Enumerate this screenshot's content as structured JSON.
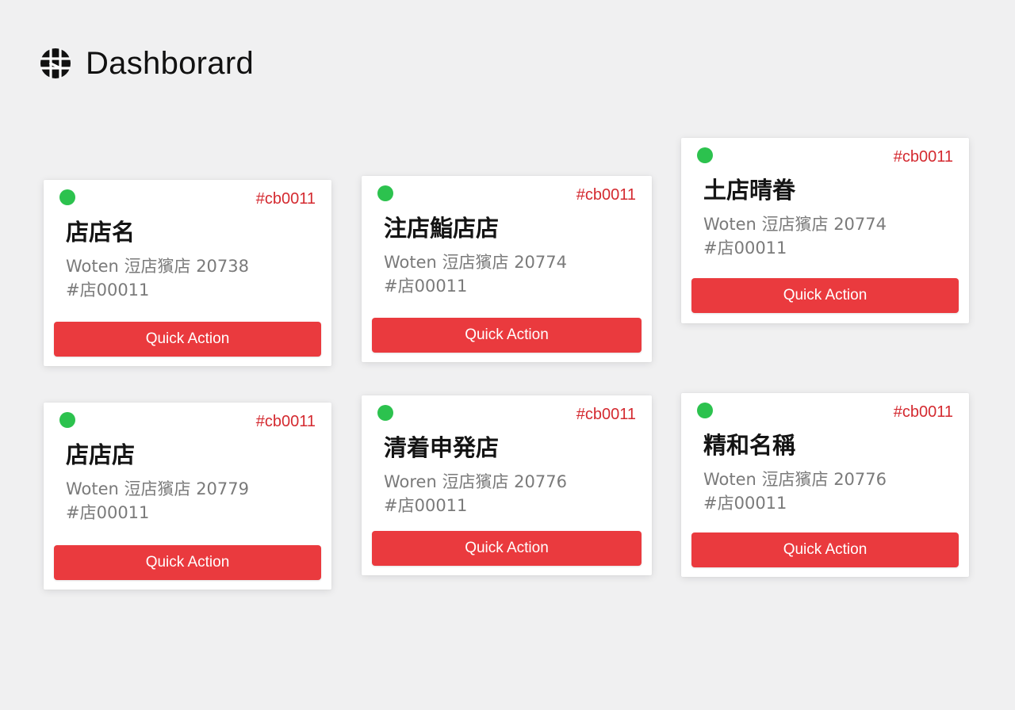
{
  "app": {
    "title": "Dashborard",
    "logo_icon": "grid-logo-icon"
  },
  "colors": {
    "accent_red": "#ea3a3e",
    "code_red": "#d42a30",
    "status_green": "#2cc24e"
  },
  "cards": [
    {
      "code": "#cb0011",
      "title": "店店名",
      "subtitle": "Woten 浢店獱店 20738",
      "ref": "#店00011",
      "action": "Quick Action",
      "status": "active"
    },
    {
      "code": "#cb0011",
      "title": "注店鮨店店",
      "subtitle": "Woten 浢店獱店 20774",
      "ref": "#店00011",
      "action": "Quick Action",
      "status": "active"
    },
    {
      "code": "#cb0011",
      "title": "土店晴眷",
      "subtitle": "Woten 浢店獱店 20774",
      "ref": "#店00011",
      "action": "Quick Action",
      "status": "active"
    },
    {
      "code": "#cb0011",
      "title": "店店店",
      "subtitle": "Woten 浢店獱店  20779",
      "ref": "#店00011",
      "action": "Quick Action",
      "status": "active"
    },
    {
      "code": "#cb0011",
      "title": "清着申発店",
      "subtitle": "Woren 浢店獱店 20776",
      "ref": "#店00011",
      "action": "Quick Action",
      "status": "active"
    },
    {
      "code": "#cb0011",
      "title": "精和名稱",
      "subtitle": "Woten 浢店獱店 20776",
      "ref": "#店00011",
      "action": "Quick Action",
      "status": "active"
    }
  ]
}
